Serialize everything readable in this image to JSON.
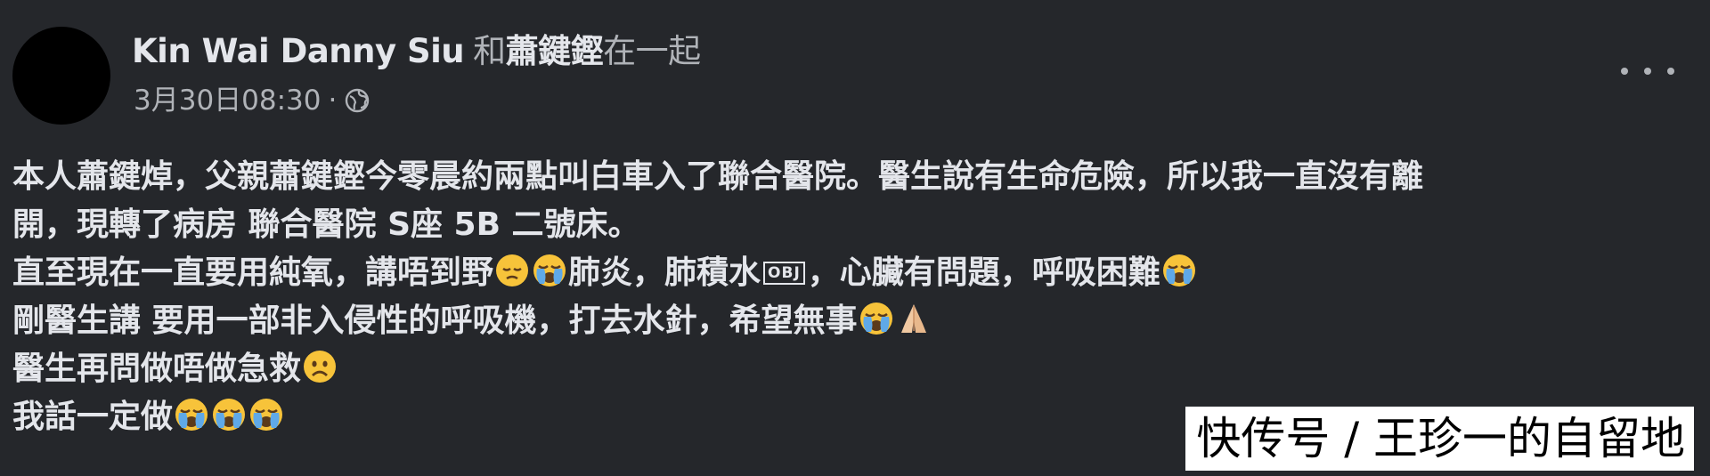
{
  "post": {
    "author": "Kin Wai Danny Siu",
    "with_text": "和",
    "tagged": "蕭鍵鏗",
    "after_text": "在一起",
    "timestamp": "3月30日08:30",
    "separator": "·",
    "privacy_icon": "globe-icon",
    "more_icon": "more-options-icon",
    "body": {
      "line1": "本人蕭鍵焯，父親蕭鍵鏗今零晨約兩點叫白車入了聯合醫院。醫生說有生命危險，所以我一直沒有離",
      "line2": "開，現轉了病房 聯合醫院 S座 5B 二號床。",
      "line3a": "直至現在一直要用純氧，講唔到野",
      "line3b": "肺炎，肺積水",
      "line3_box": "OBJ",
      "line3c": "，心臟有問題，呼吸困難",
      "line4": "剛醫生講 要用一部非入侵性的呼吸機，打去水針，希望無事",
      "line5": "醫生再問做唔做急救",
      "line6": "我話一定做"
    },
    "emojis": [
      "pensive-face-emoji",
      "loudly-crying-face-emoji",
      "folded-hands-emoji",
      "frowning-face-emoji"
    ]
  },
  "watermark": {
    "text": "快传号 / 王珍一的自留地"
  },
  "colors": {
    "background": "#25272b",
    "text_primary": "#e4e6eb",
    "text_secondary": "#b0b3b8",
    "emoji_yellow": "#f7c33a"
  }
}
